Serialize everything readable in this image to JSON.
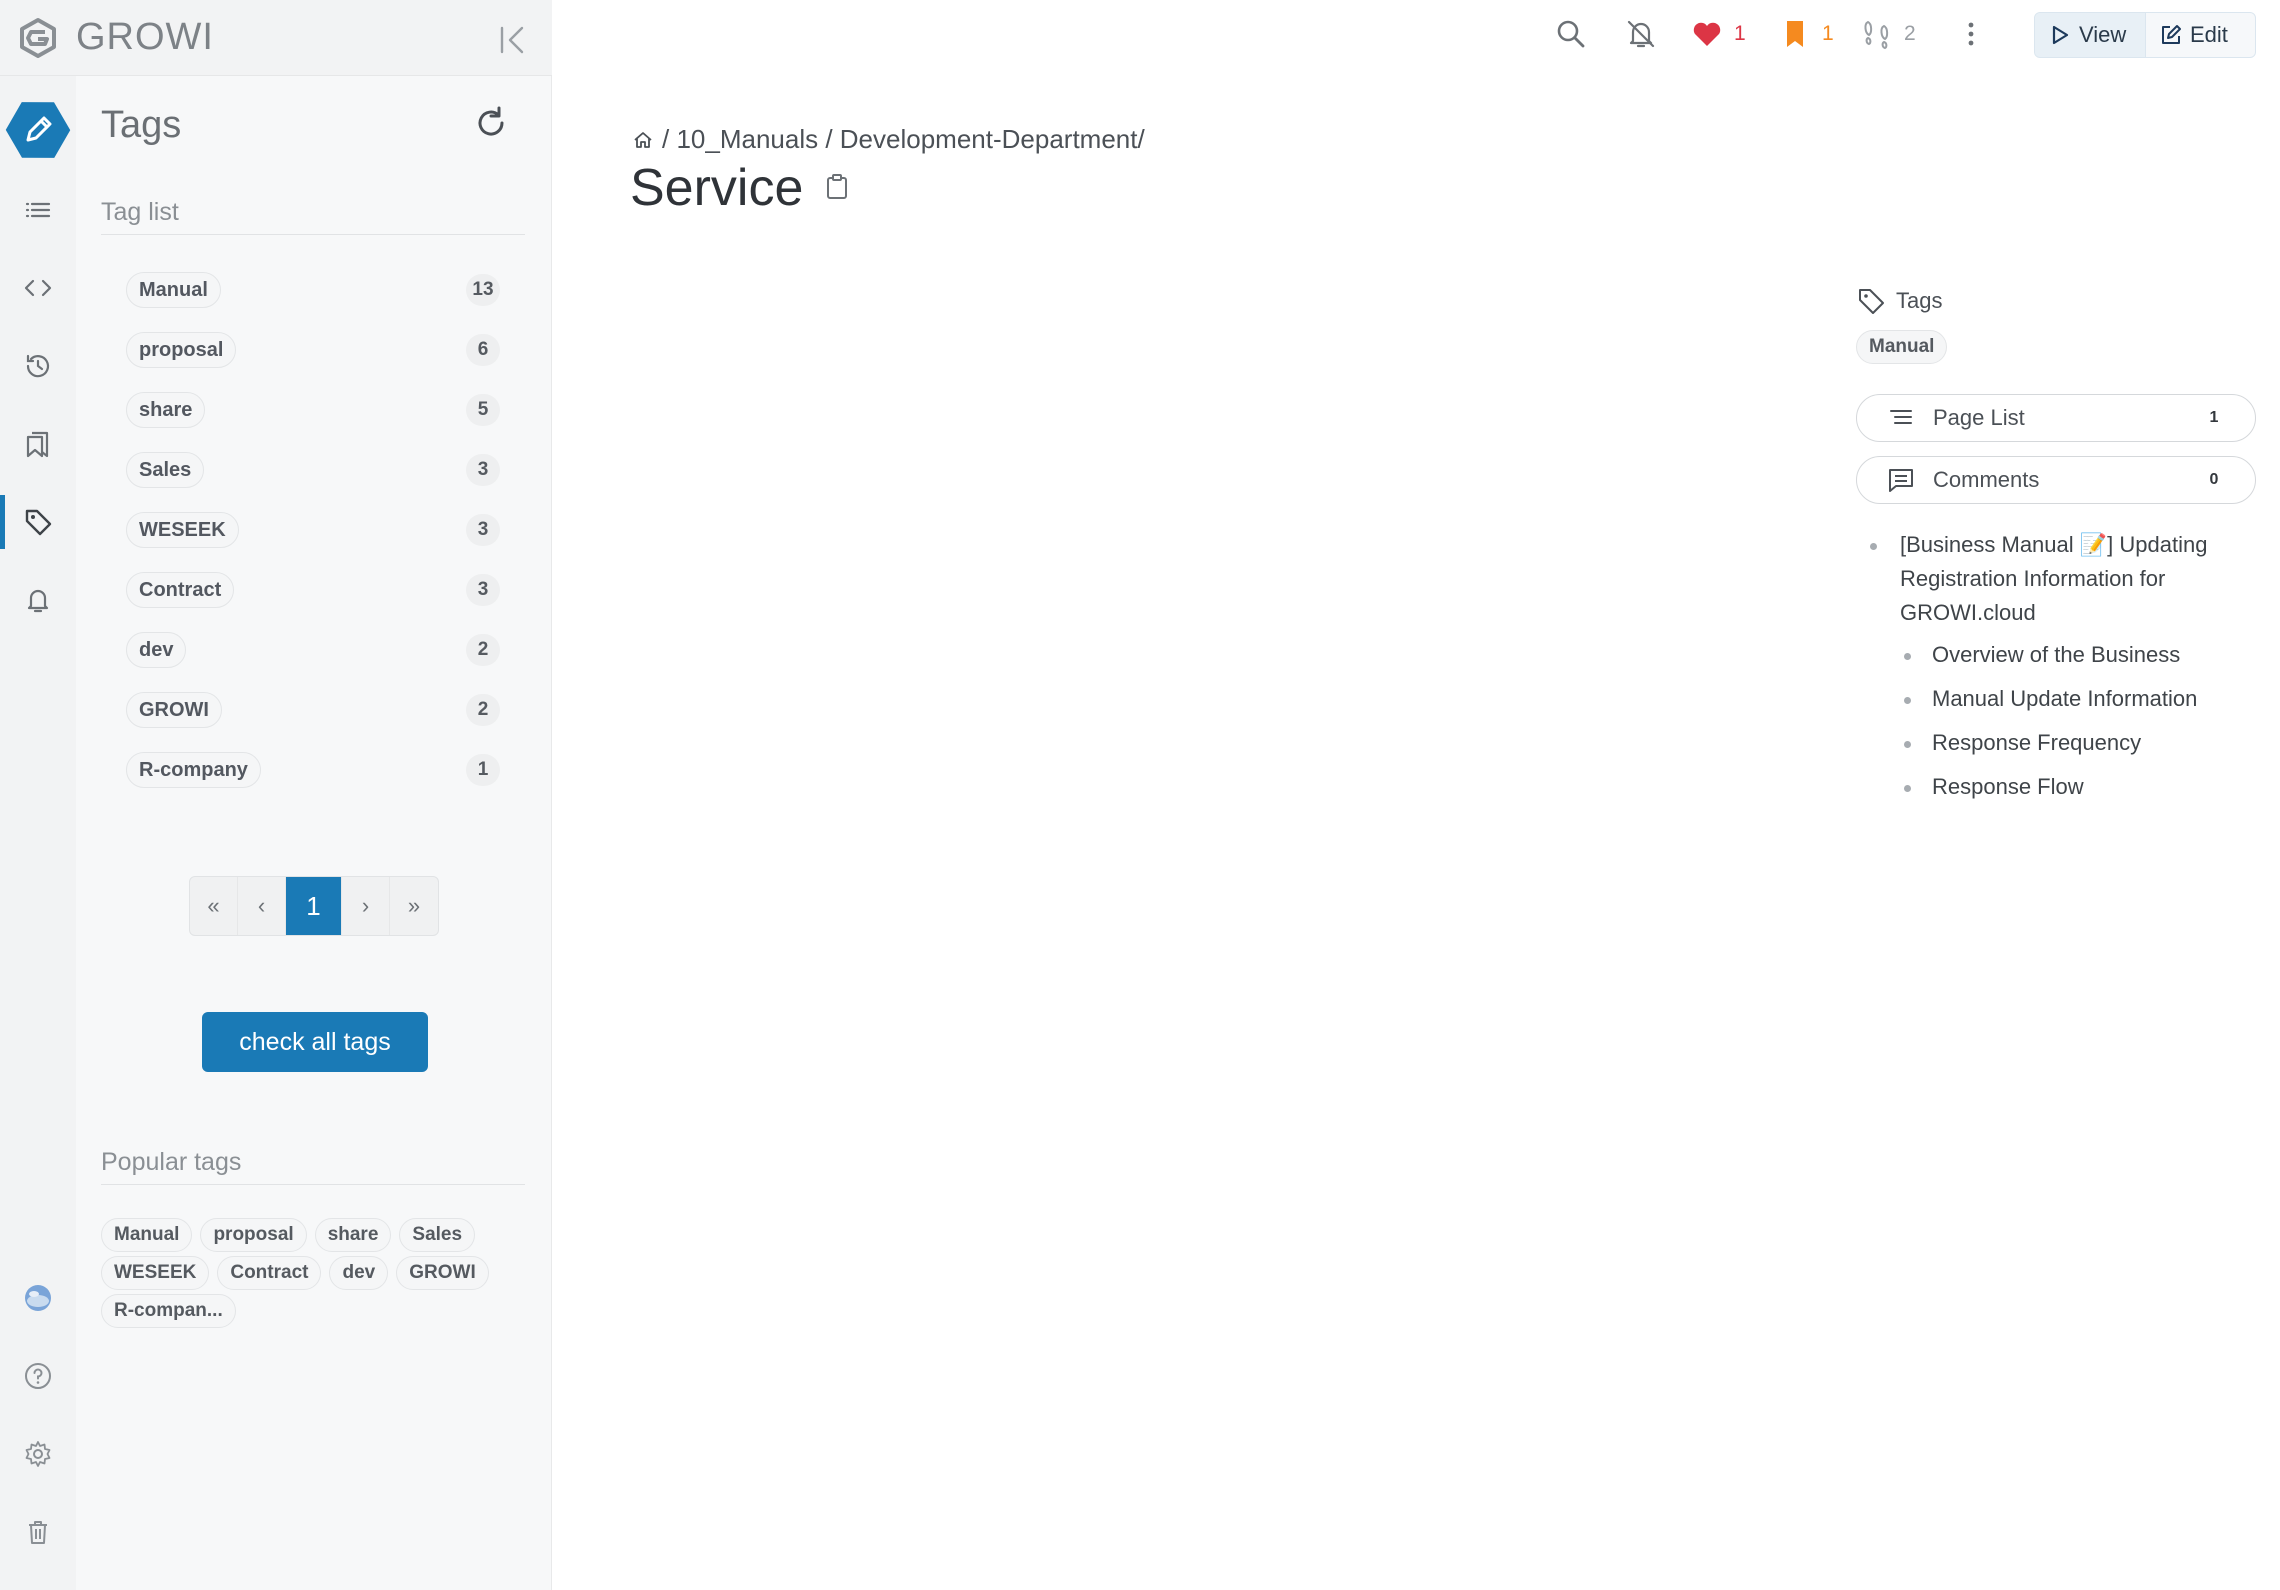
{
  "brand": {
    "name": "GROWI"
  },
  "rail": {
    "items": [
      "edit-icon",
      "page-list-icon",
      "code-icon",
      "history-icon",
      "bookmarks-icon",
      "tag-icon",
      "notification-bell-icon"
    ],
    "bottom": [
      "avatar",
      "help-icon",
      "settings-icon",
      "trash-icon"
    ],
    "active": "tag-icon",
    "accent": "#1a7ab6"
  },
  "sidebar": {
    "title": "Tags",
    "tag_list_heading": "Tag list",
    "tags": [
      {
        "name": "Manual",
        "count": "13"
      },
      {
        "name": "proposal",
        "count": "6"
      },
      {
        "name": "share",
        "count": "5"
      },
      {
        "name": "Sales",
        "count": "3"
      },
      {
        "name": "WESEEK",
        "count": "3"
      },
      {
        "name": "Contract",
        "count": "3"
      },
      {
        "name": "dev",
        "count": "2"
      },
      {
        "name": "GROWI",
        "count": "2"
      },
      {
        "name": "R-company",
        "count": "1"
      }
    ],
    "pagination": {
      "first": "«",
      "prev": "‹",
      "current": "1",
      "next": "›",
      "last": "»"
    },
    "check_all_label": "check all tags",
    "popular_heading": "Popular tags",
    "popular_tags": [
      "Manual",
      "proposal",
      "share",
      "Sales",
      "WESEEK",
      "Contract",
      "dev",
      "GROWI",
      "R-compan..."
    ]
  },
  "toolbar": {
    "likes": "1",
    "bookmarks": "1",
    "seen_users": "2",
    "like_color": "#dc3545",
    "bookmark_color": "#f58a1f",
    "view_label": "View",
    "edit_label": "Edit"
  },
  "page": {
    "breadcrumb": "/ 10_Manuals / Development-Department/",
    "title": "Service"
  },
  "side": {
    "tags_label": "Tags",
    "tags": [
      "Manual"
    ],
    "page_list_label": "Page List",
    "page_list_count": "1",
    "comments_label": "Comments",
    "comments_count": "0",
    "toc": [
      {
        "text": "[Business Manual 📝] Updating Registration Information for GROWI.cloud",
        "level": 1
      },
      {
        "text": "Overview of the Business",
        "level": 2
      },
      {
        "text": "Manual Update Information",
        "level": 2
      },
      {
        "text": "Response Frequency",
        "level": 2
      },
      {
        "text": "Response Flow",
        "level": 2
      }
    ]
  }
}
